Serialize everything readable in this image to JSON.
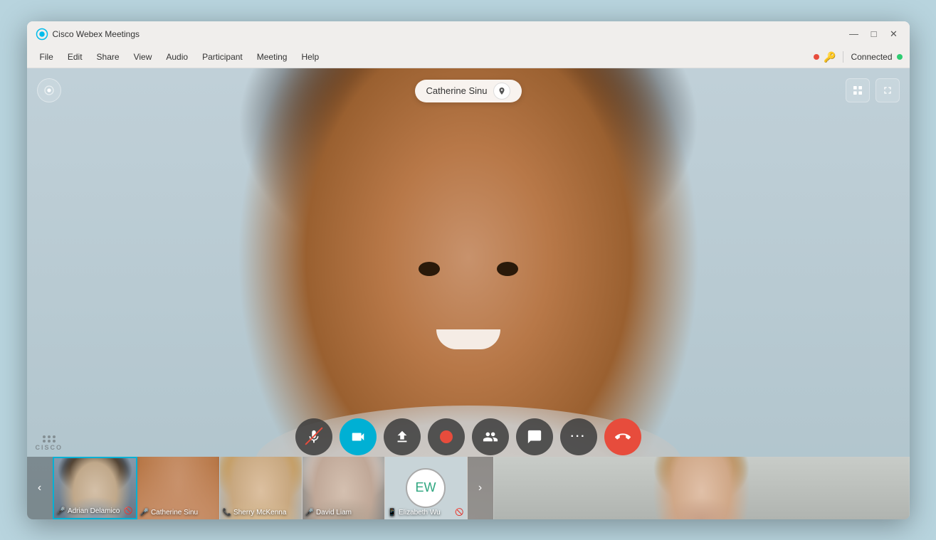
{
  "app": {
    "title": "Cisco Webex Meetings"
  },
  "titlebar": {
    "minimize": "—",
    "maximize": "□",
    "close": "✕"
  },
  "menubar": {
    "items": [
      "File",
      "Edit",
      "Share",
      "View",
      "Audio",
      "Participant",
      "Meeting",
      "Help"
    ],
    "status": "Connected"
  },
  "main_video": {
    "speaker_name": "Catherine Sinu",
    "speaker_tag_visible": true
  },
  "controls": [
    {
      "id": "mute",
      "icon": "🎤",
      "label": "Mute",
      "active": false,
      "muted": true
    },
    {
      "id": "camera",
      "icon": "📷",
      "label": "Camera",
      "active": true
    },
    {
      "id": "share",
      "icon": "⬆",
      "label": "Share",
      "active": false
    },
    {
      "id": "record",
      "icon": "⏺",
      "label": "Record",
      "active": false
    },
    {
      "id": "participants",
      "icon": "👥",
      "label": "Participants",
      "active": false
    },
    {
      "id": "chat",
      "icon": "💬",
      "label": "Chat",
      "active": false
    },
    {
      "id": "more",
      "icon": "•••",
      "label": "More",
      "active": false
    },
    {
      "id": "end",
      "icon": "✕",
      "label": "End Call",
      "active": false
    }
  ],
  "participants": [
    {
      "name": "Adrian Delamico",
      "type": "video",
      "muted": true,
      "active": true
    },
    {
      "name": "Catherine Sinu",
      "type": "video",
      "muted": false,
      "active": false
    },
    {
      "name": "Sherry McKenna",
      "type": "audio",
      "muted": false,
      "active": false
    },
    {
      "name": "David Liam",
      "type": "video",
      "muted": false,
      "active": false
    },
    {
      "name": "Elizabeth Wu",
      "type": "phone",
      "muted": true,
      "initials": "EW",
      "active": false
    }
  ],
  "extra_participant": {
    "visible": true
  }
}
